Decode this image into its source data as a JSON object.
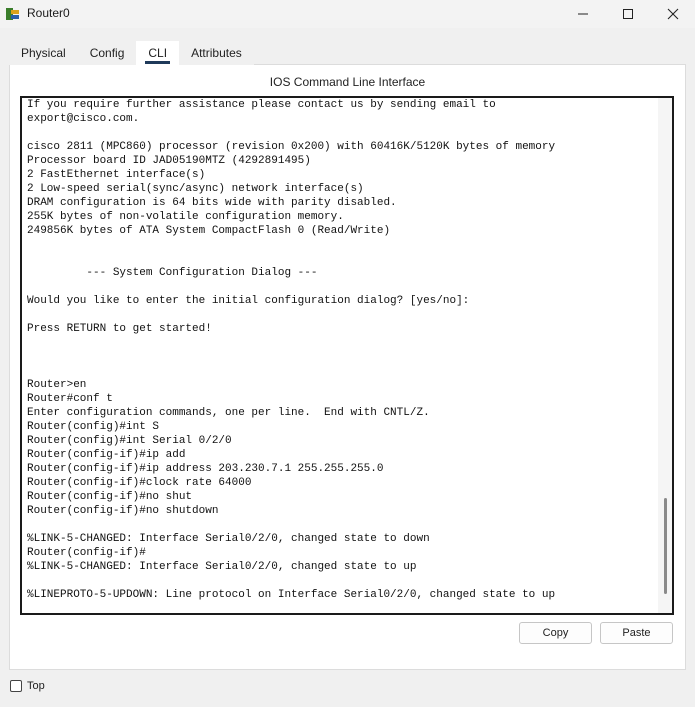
{
  "window": {
    "title": "Router0",
    "icon": "router-app-icon",
    "controls": {
      "minimize": "minimize-icon",
      "maximize": "maximize-icon",
      "close": "close-icon"
    }
  },
  "tabs": [
    {
      "label": "Physical",
      "active": false
    },
    {
      "label": "Config",
      "active": false
    },
    {
      "label": "CLI",
      "active": true
    },
    {
      "label": "Attributes",
      "active": false
    }
  ],
  "cli": {
    "heading": "IOS Command Line Interface",
    "lines": [
      "If you require further assistance please contact us by sending email to",
      "export@cisco.com.",
      "",
      "cisco 2811 (MPC860) processor (revision 0x200) with 60416K/5120K bytes of memory",
      "Processor board ID JAD05190MTZ (4292891495)",
      "2 FastEthernet interface(s)",
      "2 Low-speed serial(sync/async) network interface(s)",
      "DRAM configuration is 64 bits wide with parity disabled.",
      "255K bytes of non-volatile configuration memory.",
      "249856K bytes of ATA System CompactFlash 0 (Read/Write)",
      "",
      "",
      "         --- System Configuration Dialog ---",
      "",
      "Would you like to enter the initial configuration dialog? [yes/no]:",
      "",
      "Press RETURN to get started!",
      "",
      "",
      "",
      "Router>en",
      "Router#conf t",
      "Enter configuration commands, one per line.  End with CNTL/Z.",
      "Router(config)#int S",
      "Router(config)#int Serial 0/2/0",
      "Router(config-if)#ip add",
      "Router(config-if)#ip address 203.230.7.1 255.255.255.0",
      "Router(config-if)#clock rate 64000",
      "Router(config-if)#no shut",
      "Router(config-if)#no shutdown",
      "",
      "%LINK-5-CHANGED: Interface Serial0/2/0, changed state to down",
      "Router(config-if)#",
      "%LINK-5-CHANGED: Interface Serial0/2/0, changed state to up",
      "",
      "%LINEPROTO-5-UPDOWN: Line protocol on Interface Serial0/2/0, changed state to up"
    ]
  },
  "buttons": {
    "copy": "Copy",
    "paste": "Paste"
  },
  "top_checkbox": {
    "label": "Top",
    "checked": false
  }
}
